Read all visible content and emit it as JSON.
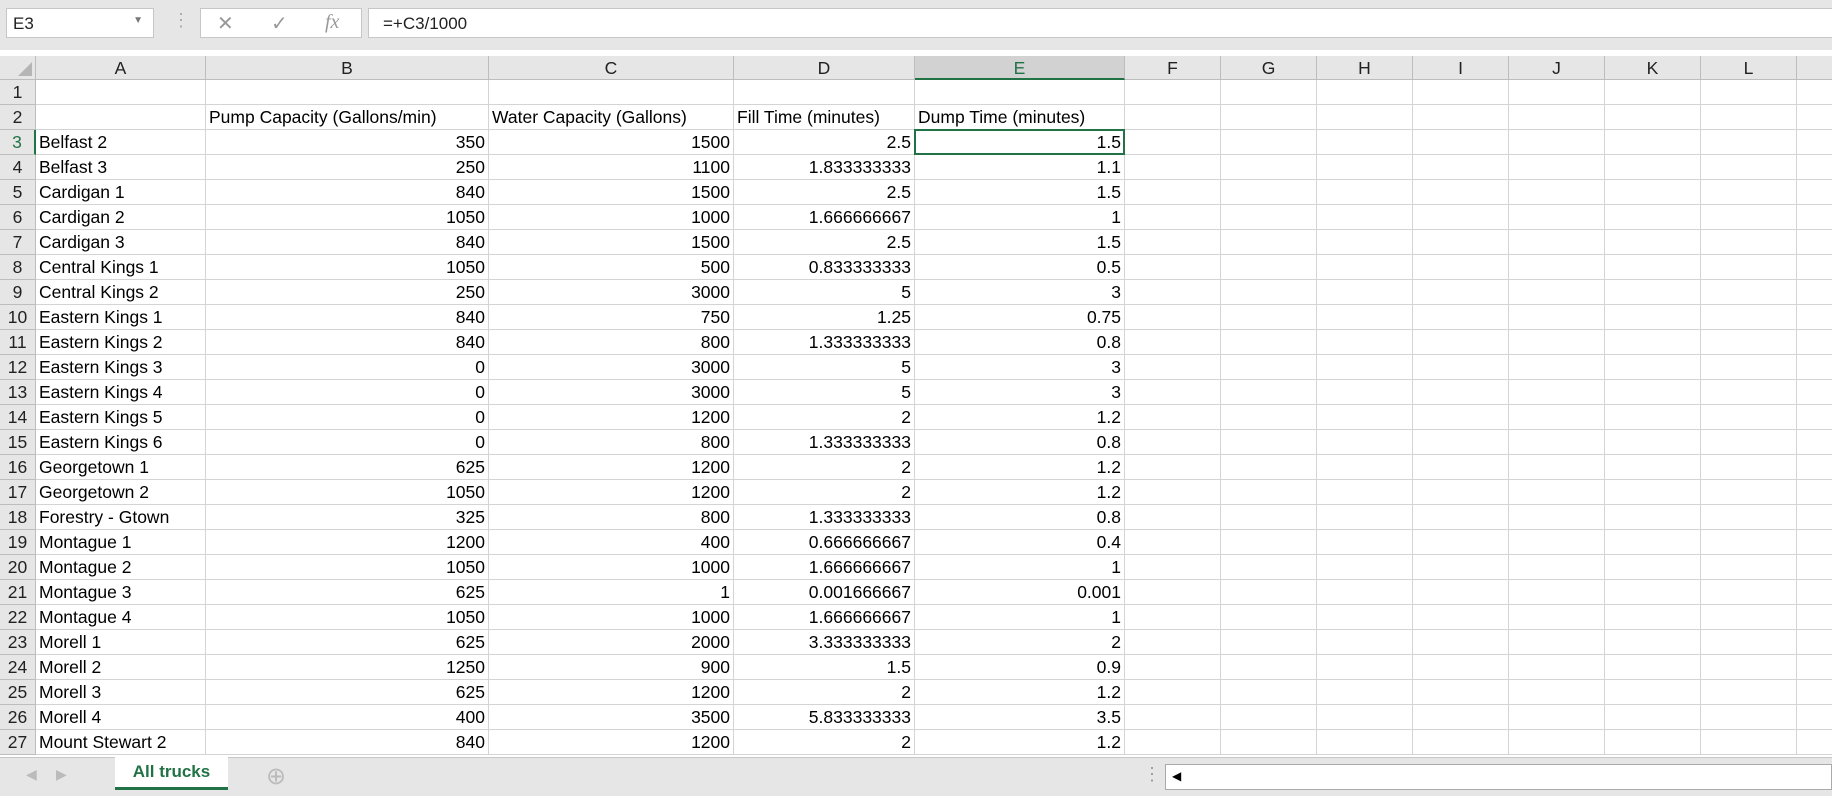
{
  "name_box": "E3",
  "formula": "=+C3/1000",
  "columns": [
    "A",
    "B",
    "C",
    "D",
    "E",
    "F",
    "G",
    "H",
    "I",
    "J",
    "K",
    "L"
  ],
  "selected_cell": "E3",
  "headers": [
    "",
    "Pump Capacity (Gallons/min)",
    "Water Capacity (Gallons)",
    "Fill Time (minutes)",
    "Dump Time (minutes)"
  ],
  "rows": [
    [
      "Belfast 2",
      "350",
      "1500",
      "2.5",
      "1.5"
    ],
    [
      "Belfast 3",
      "250",
      "1100",
      "1.833333333",
      "1.1"
    ],
    [
      "Cardigan 1",
      "840",
      "1500",
      "2.5",
      "1.5"
    ],
    [
      "Cardigan 2",
      "1050",
      "1000",
      "1.666666667",
      "1"
    ],
    [
      "Cardigan 3",
      "840",
      "1500",
      "2.5",
      "1.5"
    ],
    [
      "Central Kings 1",
      "1050",
      "500",
      "0.833333333",
      "0.5"
    ],
    [
      "Central Kings 2",
      "250",
      "3000",
      "5",
      "3"
    ],
    [
      "Eastern Kings 1",
      "840",
      "750",
      "1.25",
      "0.75"
    ],
    [
      "Eastern Kings 2",
      "840",
      "800",
      "1.333333333",
      "0.8"
    ],
    [
      "Eastern Kings 3",
      "0",
      "3000",
      "5",
      "3"
    ],
    [
      "Eastern Kings 4",
      "0",
      "3000",
      "5",
      "3"
    ],
    [
      "Eastern Kings 5",
      "0",
      "1200",
      "2",
      "1.2"
    ],
    [
      "Eastern Kings 6",
      "0",
      "800",
      "1.333333333",
      "0.8"
    ],
    [
      "Georgetown 1",
      "625",
      "1200",
      "2",
      "1.2"
    ],
    [
      "Georgetown 2",
      "1050",
      "1200",
      "2",
      "1.2"
    ],
    [
      "Forestry - Gtown",
      "325",
      "800",
      "1.333333333",
      "0.8"
    ],
    [
      "Montague 1",
      "1200",
      "400",
      "0.666666667",
      "0.4"
    ],
    [
      "Montague 2",
      "1050",
      "1000",
      "1.666666667",
      "1"
    ],
    [
      "Montague 3",
      "625",
      "1",
      "0.001666667",
      "0.001"
    ],
    [
      "Montague 4",
      "1050",
      "1000",
      "1.666666667",
      "1"
    ],
    [
      "Morell 1",
      "625",
      "2000",
      "3.333333333",
      "2"
    ],
    [
      "Morell 2",
      "1250",
      "900",
      "1.5",
      "0.9"
    ],
    [
      "Morell 3",
      "625",
      "1200",
      "2",
      "1.2"
    ],
    [
      "Morell 4",
      "400",
      "3500",
      "5.833333333",
      "3.5"
    ],
    [
      "Mount Stewart 2",
      "840",
      "1200",
      "2",
      "1.2"
    ]
  ],
  "sheet_tab": "All trucks",
  "icons": {
    "cancel": "✕",
    "enter": "✓",
    "fx": "fx",
    "add_sheet": "⊕"
  }
}
